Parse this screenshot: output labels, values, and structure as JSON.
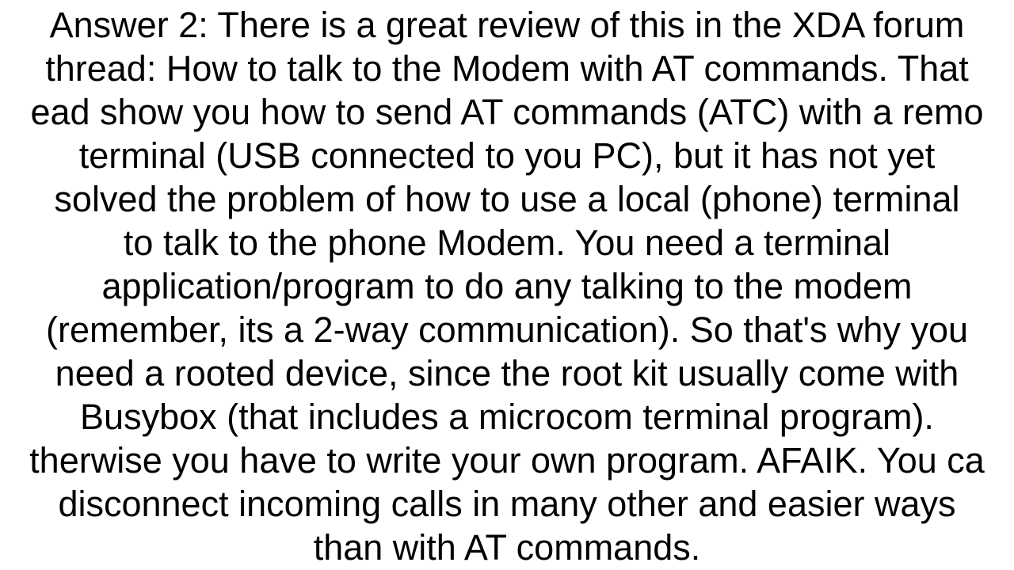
{
  "answer": {
    "label": "Answer 2:",
    "lines": [
      "Answer 2:  There is a great review of this in the XDA forum",
      "thread: How to talk to the Modem with AT commands. That",
      "ead show you how to send AT commands (ATC) with a remo",
      "terminal (USB connected to you PC), but it has not yet",
      "solved the  problem of how to use a local (phone) terminal",
      "to talk to the  phone Modem. You need a terminal",
      "application/program to do any talking to the modem",
      "(remember, its a 2-way communication). So that's why you",
      "need a rooted device, since the root kit usually come with",
      "Busybox (that includes a microcom terminal program).",
      "therwise you have to write your own program. AFAIK. You ca",
      "disconnect incoming calls in many other and easier  ways",
      "than with AT commands."
    ]
  }
}
